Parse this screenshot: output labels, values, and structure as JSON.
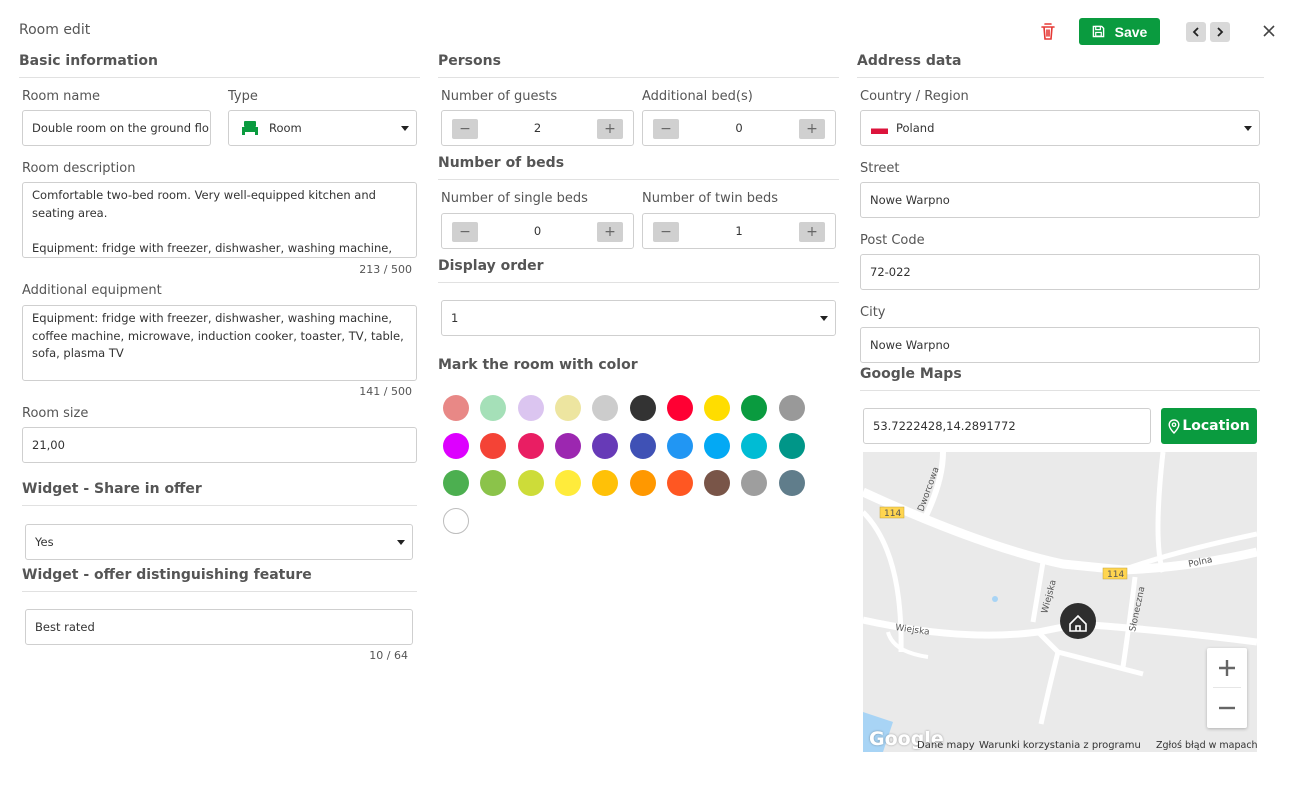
{
  "header": {
    "title": "Room edit",
    "save_label": "Save",
    "colors": {
      "primary": "#0a9b3f",
      "danger": "#e53935"
    }
  },
  "basic": {
    "heading": "Basic information",
    "room_name_label": "Room name",
    "room_name_value": "Double room on the ground flo",
    "type_label": "Type",
    "type_value": "Room",
    "description_label": "Room description",
    "description_value": "Comfortable two-bed room. Very well-equipped kitchen and seating area.\n\nEquipment: fridge with freezer, dishwasher, washing machine, coffee machine, microwave, induction cooker, toaster, TV, table",
    "description_counter": "213 / 500",
    "equipment_label": "Additional equipment",
    "equipment_value": "Equipment: fridge with freezer, dishwasher, washing machine, coffee machine, microwave, induction cooker, toaster, TV, table, sofa, plasma TV",
    "equipment_counter": "141 / 500",
    "size_label": "Room size",
    "size_value": "21,00"
  },
  "widget_share": {
    "heading": "Widget - Share in offer",
    "value": "Yes"
  },
  "widget_feature": {
    "heading": "Widget - offer distinguishing feature",
    "value": "Best rated",
    "counter": "10 / 64"
  },
  "persons": {
    "heading": "Persons",
    "guests_label": "Number of guests",
    "guests_value": "2",
    "extra_beds_label": "Additional bed(s)",
    "extra_beds_value": "0"
  },
  "beds": {
    "heading": "Number of beds",
    "single_label": "Number of single beds",
    "single_value": "0",
    "twin_label": "Number of twin beds",
    "twin_value": "1"
  },
  "display_order": {
    "heading": "Display order",
    "value": "1"
  },
  "stepper": {
    "minus": "−",
    "plus": "+"
  },
  "color_mark": {
    "heading": "Mark the room with color",
    "swatches": [
      "#e88886",
      "#a5e0b8",
      "#dbc5f0",
      "#ede5a0",
      "#cccccc",
      "#333333",
      "#ff0033",
      "#ffdd00",
      "#0a9b3f",
      "#999999",
      "#dd00ff",
      "#f44336",
      "#e91e63",
      "#9c27b0",
      "#673ab7",
      "#3f51b5",
      "#2196f3",
      "#03a9f4",
      "#00bcd4",
      "#009688",
      "#4caf50",
      "#8bc34a",
      "#cddc39",
      "#ffeb3b",
      "#ffc107",
      "#ff9800",
      "#ff5722",
      "#795548",
      "#9e9e9e",
      "#607d8b",
      "#ffffff"
    ]
  },
  "address": {
    "heading": "Address data",
    "country_label": "Country / Region",
    "country_value": "Poland",
    "street_label": "Street",
    "street_value": "Nowe Warpno",
    "postcode_label": "Post Code",
    "postcode_value": "72-022",
    "city_label": "City",
    "city_value": "Nowe Warpno"
  },
  "maps": {
    "heading": "Google Maps",
    "coords_value": "53.7222428,14.2891772",
    "location_label": "Location",
    "roads": {
      "r114a": "114",
      "r114b": "114",
      "dworcowa": "Dworcowa",
      "polna": "Polna",
      "wiejska1": "Wiejska",
      "wiejska2": "Wiejska",
      "sloneczna": "Słoneczna"
    },
    "logo": "Google",
    "footer_data": "Dane mapy",
    "footer_terms": "Warunki korzystania z programu",
    "footer_report": "Zgłoś błąd w mapach"
  }
}
